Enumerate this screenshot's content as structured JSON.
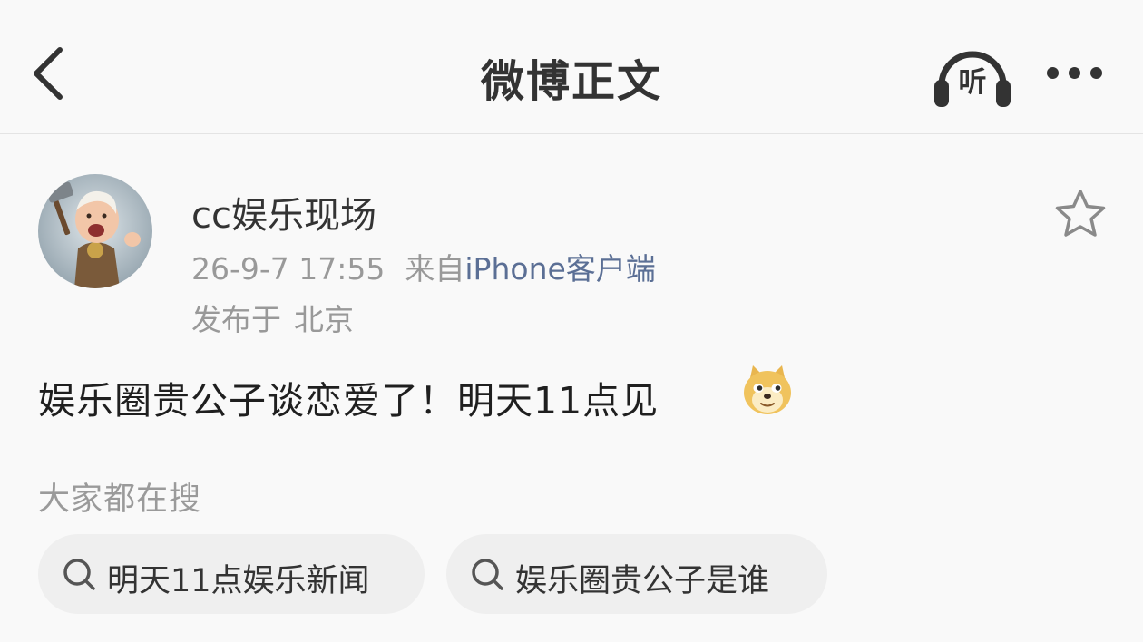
{
  "navbar": {
    "title": "微博正文",
    "listen_label": "听"
  },
  "post": {
    "username": "cc娱乐现场",
    "time": "26-9-7 17:55",
    "source_prefix": "来自",
    "source": "iPhone客户端",
    "location_label": "发布于",
    "location": "北京",
    "text": "娱乐圈贵公子谈恋爱了！明天11点见"
  },
  "trending": {
    "label": "大家都在搜",
    "items": [
      "明天11点娱乐新闻",
      "娱乐圈贵公子是谁"
    ]
  },
  "colors": {
    "background": "#f9f9f9",
    "source_link": "#5b6f95",
    "chip_bg": "#efefef"
  }
}
